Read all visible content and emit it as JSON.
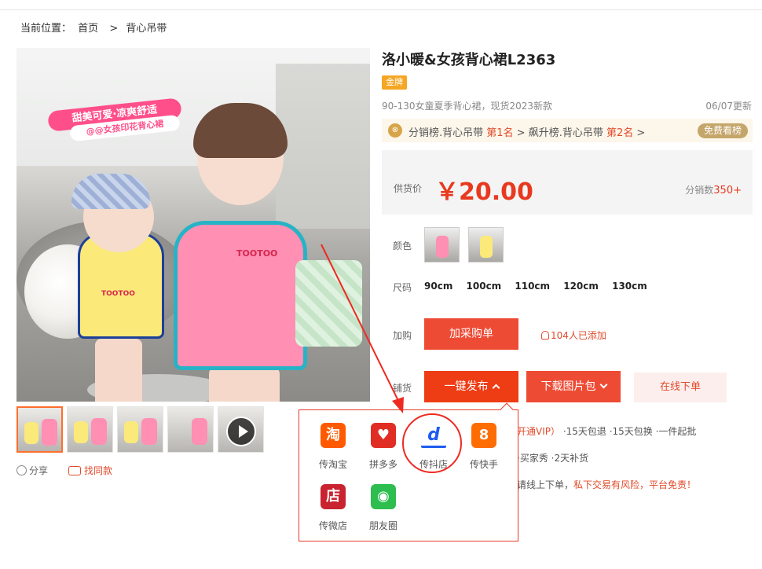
{
  "breadcrumb": {
    "label": "当前位置：",
    "home": "首页",
    "separator": ">",
    "current": "背心吊带"
  },
  "main_image": {
    "tag_line1": "甜美可爱·凉爽舒适",
    "tag_line2": "@@女孩印花背心裙",
    "print_text": "TOOTOO"
  },
  "share": {
    "share_label": "分享",
    "same_label": "找同款"
  },
  "product": {
    "title": "洛小暖&女孩背心裙L2363",
    "badge": "金牌",
    "subtitle": "90-130女童夏季背心裙，现货2023新款",
    "update": "06/07更新"
  },
  "rank": {
    "medal": "⊗",
    "part1": "分销榜.背心吊带 ",
    "rank1": "第1名",
    "part2": " > 飙升榜.背心吊带 ",
    "rank2": "第2名",
    "part3": " >",
    "free_label": "免费看榜"
  },
  "price": {
    "label": "供货价",
    "value": "￥20.00",
    "sales_label": "分销数",
    "sales_value": "350+"
  },
  "color": {
    "label": "颜色"
  },
  "size": {
    "label": "尺码",
    "options": [
      "90cm",
      "100cm",
      "110cm",
      "120cm",
      "130cm"
    ]
  },
  "cart": {
    "label": "加购",
    "button": "加采购单",
    "added": "104人已添加"
  },
  "stock": {
    "label": "铺货",
    "publish": "一键发布",
    "download": "下载图片包",
    "online": "在线下单"
  },
  "services": {
    "line1_red": "开通VIP）",
    "line1": " ·15天包退  ·15天包换  ·一件起批",
    "line2": "·买家秀  ·2天补货",
    "line3": "请线上下单，",
    "line3_red": "私下交易有风险，平台免责！"
  },
  "platforms": [
    {
      "glyph": "淘",
      "label": "传淘宝",
      "color": "#ff5a00"
    },
    {
      "glyph": "♥",
      "label": "拼多多",
      "color": "#e02e24"
    },
    {
      "glyph": "d",
      "label": "传抖店",
      "color": "#ffffff"
    },
    {
      "glyph": "8",
      "label": "传快手",
      "color": "#ff6d00"
    },
    {
      "glyph": "店",
      "label": "传微店",
      "color": "#c9232f"
    },
    {
      "glyph": "◉",
      "label": "朋友圈",
      "color": "#2ebd4f"
    }
  ]
}
